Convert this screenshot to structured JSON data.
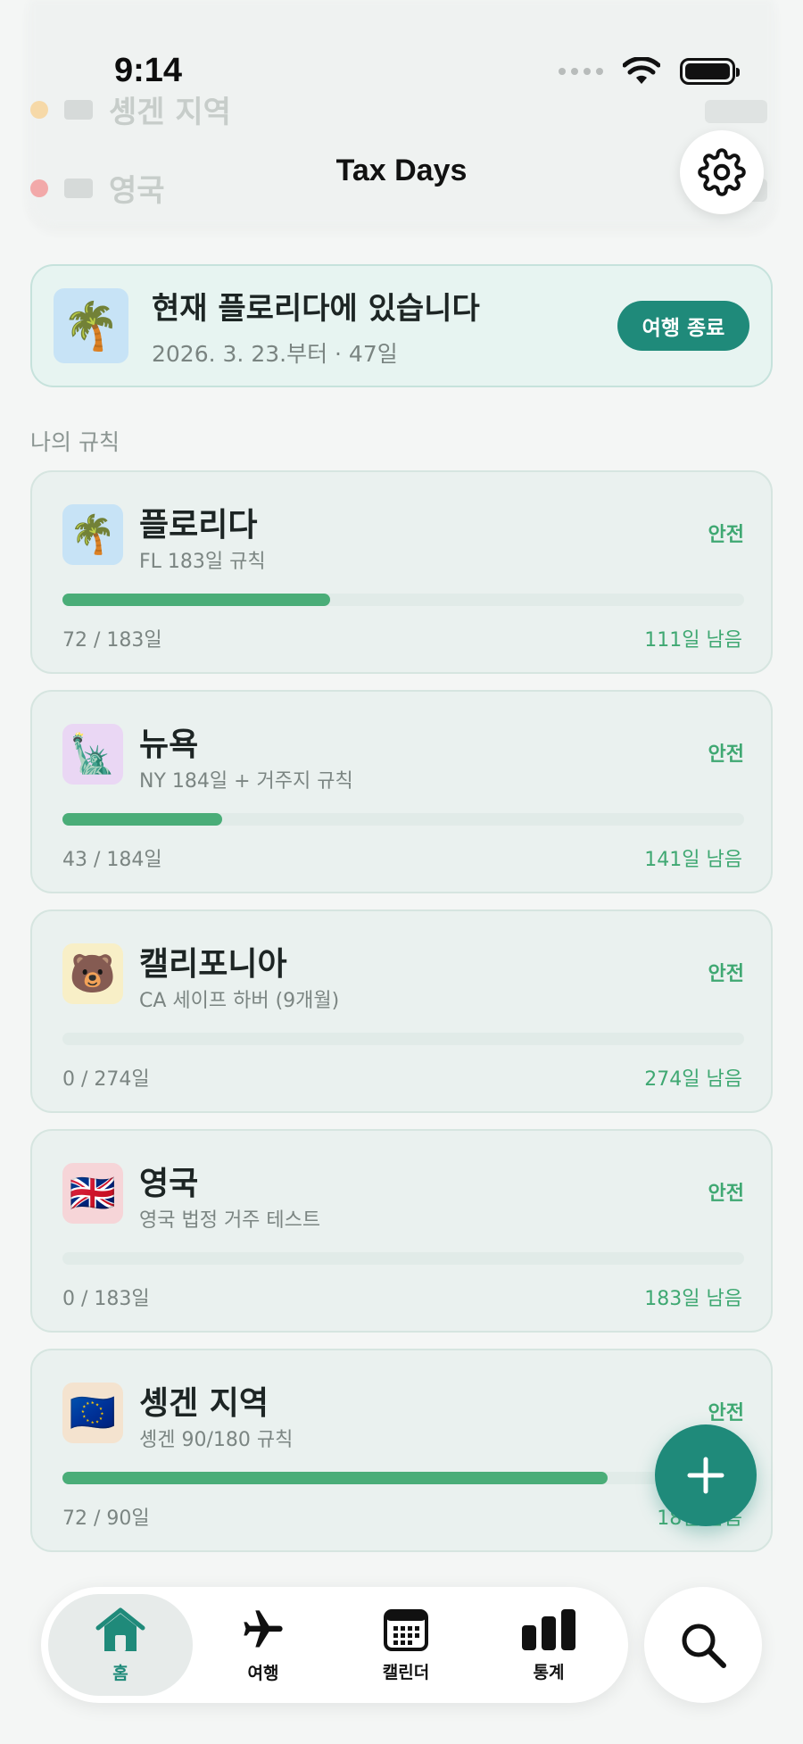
{
  "status_bar": {
    "time": "9:14"
  },
  "header": {
    "title": "Tax Days"
  },
  "background_rows": [
    {
      "name": "영국",
      "dot_color": "#e04b4b"
    },
    {
      "name": "솅겐 지역",
      "dot_color": "#f3b14a"
    }
  ],
  "current_location": {
    "emoji": "🌴",
    "title": "현재 플로리다에 있습니다",
    "subtitle": "2026. 3. 23.부터 · 47일",
    "end_button": "여행 종료"
  },
  "section_title": "나의 규칙",
  "rules": [
    {
      "emoji": "🌴",
      "tile_color": "#c7e3f6",
      "name": "플로리다",
      "subtitle": "FL 183일 규칙",
      "badge": "안전",
      "count": "72 / 183일",
      "remaining": "111일 남음",
      "progress": 0.393
    },
    {
      "emoji": "🗽",
      "tile_color": "#ead7f4",
      "name": "뉴욕",
      "subtitle": "NY 184일 + 거주지 규칙",
      "badge": "안전",
      "count": "43 / 184일",
      "remaining": "141일 남음",
      "progress": 0.234
    },
    {
      "emoji": "🐻",
      "tile_color": "#f8efc7",
      "name": "캘리포니아",
      "subtitle": "CA 세이프 하버 (9개월)",
      "badge": "안전",
      "count": "0 / 274일",
      "remaining": "274일 남음",
      "progress": 0
    },
    {
      "emoji": "🇬🇧",
      "tile_color": "#f6d5d8",
      "name": "영국",
      "subtitle": "영국 법정 거주 테스트",
      "badge": "안전",
      "count": "0 / 183일",
      "remaining": "183일 남음",
      "progress": 0
    },
    {
      "emoji": "🇪🇺",
      "tile_color": "#f4e3cf",
      "name": "솅겐 지역",
      "subtitle": "솅겐 90/180 규칙",
      "badge": "안전",
      "count": "72 / 90일",
      "remaining": "18일 남음",
      "progress": 0.8
    }
  ],
  "tabs": [
    {
      "label": "홈",
      "icon": "home-icon",
      "active": true
    },
    {
      "label": "여행",
      "icon": "airplane-icon",
      "active": false
    },
    {
      "label": "캘린더",
      "icon": "calendar-icon",
      "active": false
    },
    {
      "label": "통계",
      "icon": "bar-chart-icon",
      "active": false
    }
  ],
  "colors": {
    "accent": "#1f8a7a",
    "safe": "#3fa872",
    "progress": "#4aad78"
  }
}
